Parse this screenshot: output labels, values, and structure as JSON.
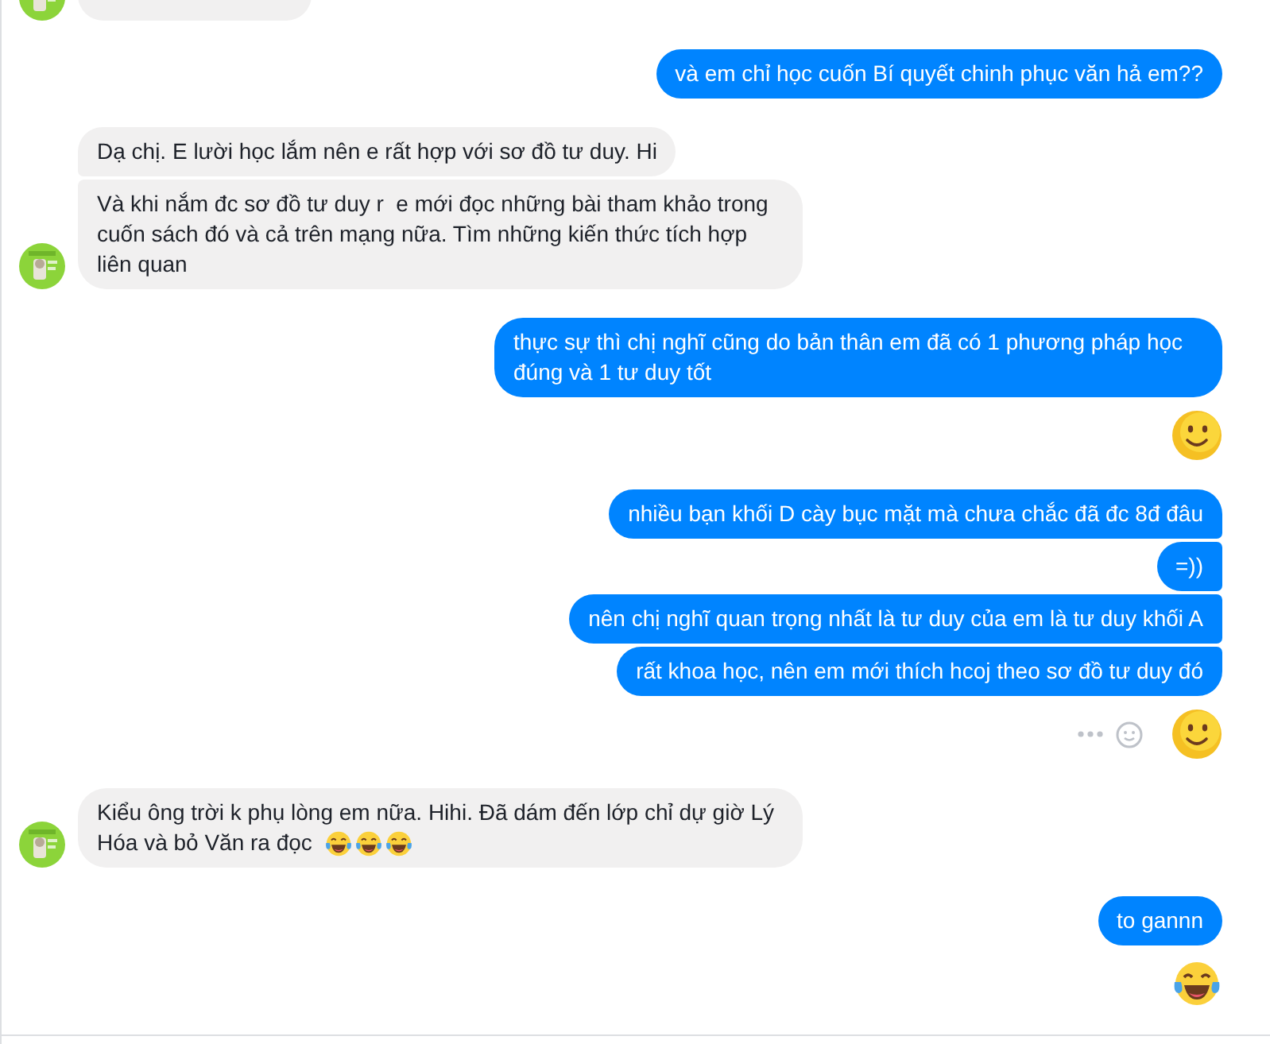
{
  "messages": [
    {
      "kind": "clipped"
    },
    {
      "kind": "outgoing",
      "bubbles": [
        {
          "text": "và em chỉ học cuốn Bí quyết chinh phục văn hả em??"
        }
      ]
    },
    {
      "kind": "incoming",
      "bubbles": [
        {
          "text": "Dạ chị. E lười học lắm nên e rất hợp với sơ đồ tư duy. Hi"
        },
        {
          "text": "Và khi nắm đc sơ đồ tư duy r  e mới đọc những bài tham khảo trong cuốn sách đó và cả trên mạng nữa. Tìm những kiến thức tích hợp liên quan"
        }
      ]
    },
    {
      "kind": "outgoing",
      "bubbles": [
        {
          "text": "thực sự thì chị nghĩ cũng do bản thân em đã có 1 phương pháp học đúng và 1 tư duy tốt"
        }
      ]
    },
    {
      "kind": "smile",
      "hover_actions": false
    },
    {
      "kind": "outgoing",
      "bubbles": [
        {
          "text": "nhiều bạn khối D cày bục mặt mà chưa chắc đã đc 8đ đâu"
        },
        {
          "text": "=))"
        },
        {
          "text": "nên chị nghĩ quan trọng nhất là tư duy của em là tư duy khối A"
        },
        {
          "text": "rất khoa học, nên em mới thích hcoj theo sơ đồ tư duy đó"
        }
      ]
    },
    {
      "kind": "smile",
      "hover_actions": true
    },
    {
      "kind": "incoming",
      "bubbles": [
        {
          "text": "Kiểu ông trời k phụ lòng em nữa. Hihi. Đã dám đến lớp chỉ dự giờ Lý Hóa và bỏ Văn ra đọc",
          "emojis": [
            {
              "kind": "laugh"
            },
            {
              "kind": "laugh"
            },
            {
              "kind": "laugh"
            }
          ]
        }
      ]
    },
    {
      "kind": "outgoing",
      "bubbles": [
        {
          "text": "to gannn"
        }
      ]
    },
    {
      "kind": "laugh",
      "hover_actions": false
    }
  ]
}
